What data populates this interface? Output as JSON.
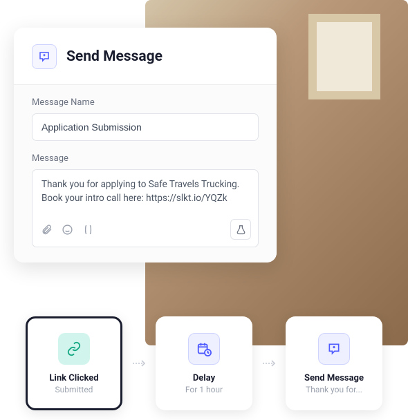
{
  "main_card": {
    "title": "Send Message",
    "name_label": "Message Name",
    "name_value": "Application Submission",
    "message_label": "Message",
    "message_value": "Thank you for applying to Safe Travels Trucking. Book your intro call here: https://slkt.io/YQZk"
  },
  "workflow": {
    "step1": {
      "title": "Link Clicked",
      "sub": "Submitted"
    },
    "step2": {
      "title": "Delay",
      "sub": "For 1 hour"
    },
    "step3": {
      "title": "Send Message",
      "sub": "Thank you for..."
    }
  }
}
